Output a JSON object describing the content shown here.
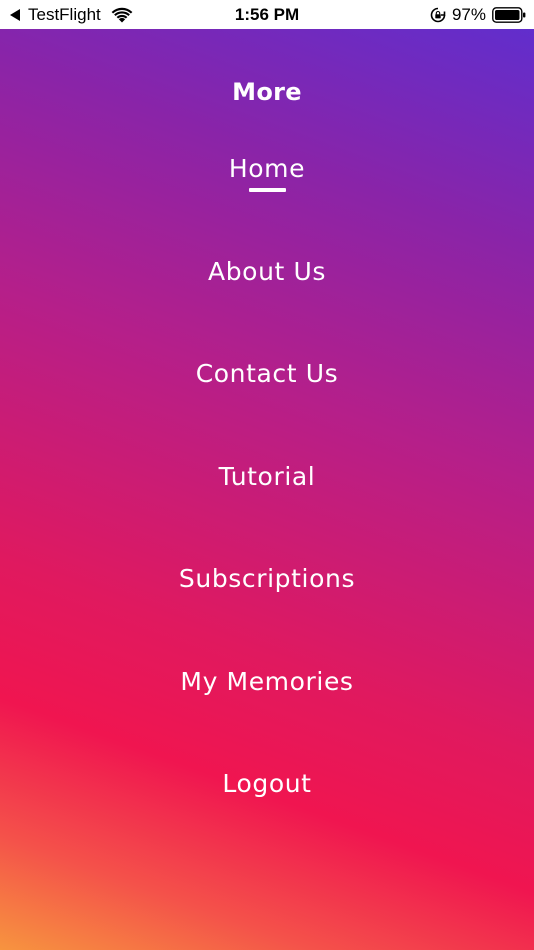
{
  "status_bar": {
    "back_app": "TestFlight",
    "time": "1:56 PM",
    "battery": "97%"
  },
  "menu": {
    "title": "More",
    "active_item": "Home",
    "items": [
      {
        "label": "Home"
      },
      {
        "label": "About Us"
      },
      {
        "label": "Contact Us"
      },
      {
        "label": "Tutorial"
      },
      {
        "label": "Subscriptions"
      },
      {
        "label": "My Memories"
      },
      {
        "label": "Logout"
      }
    ]
  },
  "colors": {
    "gradient_top": "#5c2fd1",
    "gradient_mid": "#e0195f",
    "gradient_bottom": "#f7943f",
    "text": "#ffffff"
  },
  "icons": [
    "back-chevron-icon",
    "wifi-icon",
    "orientation-lock-icon",
    "battery-icon"
  ]
}
